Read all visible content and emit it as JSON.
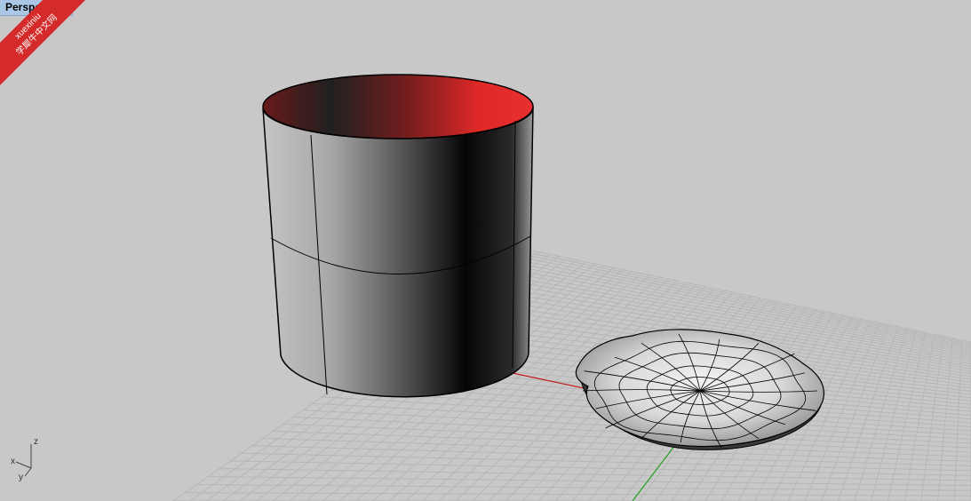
{
  "viewport": {
    "tab_label": "Perspective",
    "axis_labels": {
      "x": "x",
      "y": "y",
      "z": "z"
    }
  },
  "watermark": {
    "line1": "xuexiniu",
    "line2": "学犀牛中文网"
  },
  "colors": {
    "background": "#c8c8c8",
    "grid_line": "#b4b4b4",
    "x_axis": "#c02020",
    "y_axis": "#20a020",
    "tab_bg": "#aac8e6",
    "cylinder_interior": "#e02828",
    "watermark_bg": "#d42a2a"
  },
  "scene_objects": [
    "cylinder",
    "dish"
  ]
}
